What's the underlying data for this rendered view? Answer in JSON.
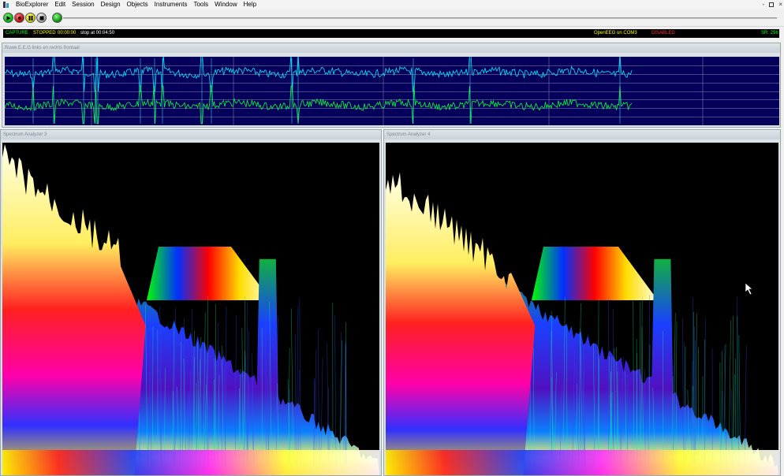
{
  "app": {
    "name": "BioExplorer"
  },
  "menu": [
    "Edit",
    "Session",
    "Design",
    "Objects",
    "Instruments",
    "Tools",
    "Window",
    "Help"
  ],
  "window_controls": [
    "-",
    "×"
  ],
  "toolbar": {
    "buttons": [
      "play",
      "record",
      "pause",
      "stop",
      "indicator"
    ]
  },
  "status": {
    "capture": "CAPTURE",
    "state": "STOPPED",
    "time": "00:00:00",
    "stop_at": "stop at 00:04:50",
    "device": "OpenEEG on COM3",
    "disabled": "DISABLED",
    "sample_rate": "SR: 256"
  },
  "colors": {
    "status_green": "#00ff00",
    "status_yellow": "#ffff00",
    "status_red": "#ff3030",
    "eeg_channel1": "#00e8ff",
    "eeg_channel2": "#00ff40",
    "eeg_bg": "#05005a"
  },
  "panels": {
    "eeg": {
      "title": "Ruwe E.E.G links en rechts frontaal"
    },
    "spectrum1": {
      "title": "Spectrum Analyzer 3"
    },
    "spectrum2": {
      "title": "Spectrum Analyzer 4"
    }
  }
}
